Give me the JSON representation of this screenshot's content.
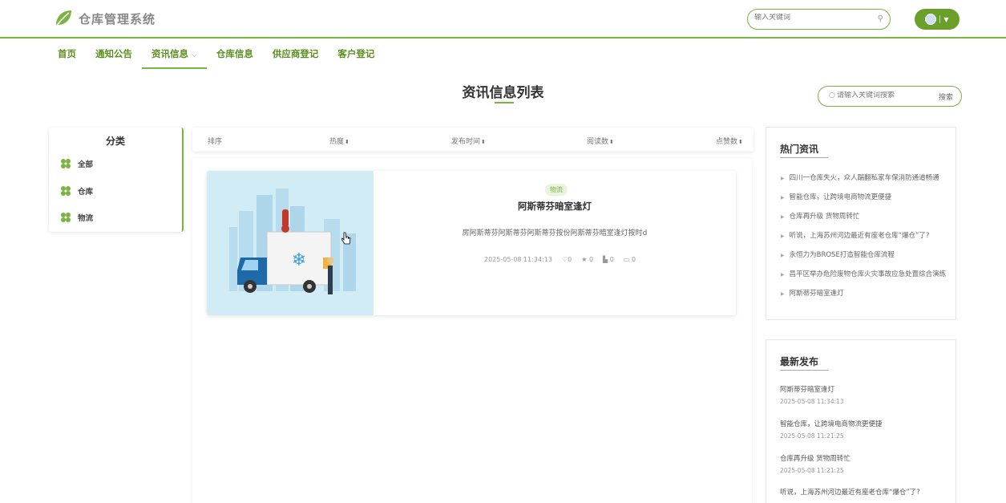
{
  "header": {
    "logo_text": "仓库管理系统",
    "search_placeholder": "输入关键词",
    "search_icon": "search-icon",
    "accent_color": "#7cb342"
  },
  "nav": {
    "items": [
      {
        "label": "首页"
      },
      {
        "label": "通知公告"
      },
      {
        "label": "资讯信息"
      },
      {
        "label": "仓库信息"
      },
      {
        "label": "供应商登记"
      },
      {
        "label": "客户登记"
      }
    ]
  },
  "page": {
    "title": "资讯信息列表",
    "search_placeholder": "请输入关键词搜索",
    "search_button": "搜索"
  },
  "category": {
    "title": "分类",
    "items": [
      {
        "label": "全部"
      },
      {
        "label": "仓库"
      },
      {
        "label": "物流"
      }
    ]
  },
  "sort": {
    "items": [
      {
        "label": "排序"
      },
      {
        "label": "热度"
      },
      {
        "label": "发布时间"
      },
      {
        "label": "阅读数"
      },
      {
        "label": "点赞数"
      }
    ]
  },
  "card": {
    "tag": "物流",
    "title": "阿斯蒂芬暗室逢灯",
    "desc": "房阿斯蒂芬阿斯蒂芬阿斯蒂芬按份阿斯蒂芬暗室逢灯按时d",
    "time": "2025-05-08 11:34:13",
    "likes": "0",
    "stars": "0",
    "views": "0",
    "comments": "0"
  },
  "hot": {
    "title": "热门资讯",
    "items": [
      {
        "label": "四川一仓库失火，众人踹翻私家车保消防通道畅通"
      },
      {
        "label": "智能仓库，让跨境电商物流更便捷"
      },
      {
        "label": "仓库再升级 货物周转忙"
      },
      {
        "label": "听说，上海苏州河边最近有座老仓库“爆仓”了?"
      },
      {
        "label": "永恒力为BROSE打造智能仓库流程"
      },
      {
        "label": "昌平区举办危险废物仓库火灾事故应急处置综合演练"
      },
      {
        "label": "阿斯蒂芬暗室逢灯"
      }
    ]
  },
  "latest": {
    "title": "最新发布",
    "items": [
      {
        "label": "阿斯蒂芬暗室逢灯",
        "time": "2025-05-08 11:34:13"
      },
      {
        "label": "智能仓库，让跨境电商物流更便捷",
        "time": "2025-05-08 11:21:25"
      },
      {
        "label": "仓库再升级 货物周转忙",
        "time": "2025-05-08 11:21:25"
      },
      {
        "label": "听说，上海苏州河边最近有座老仓库“爆仓”了?",
        "time": ""
      }
    ]
  }
}
